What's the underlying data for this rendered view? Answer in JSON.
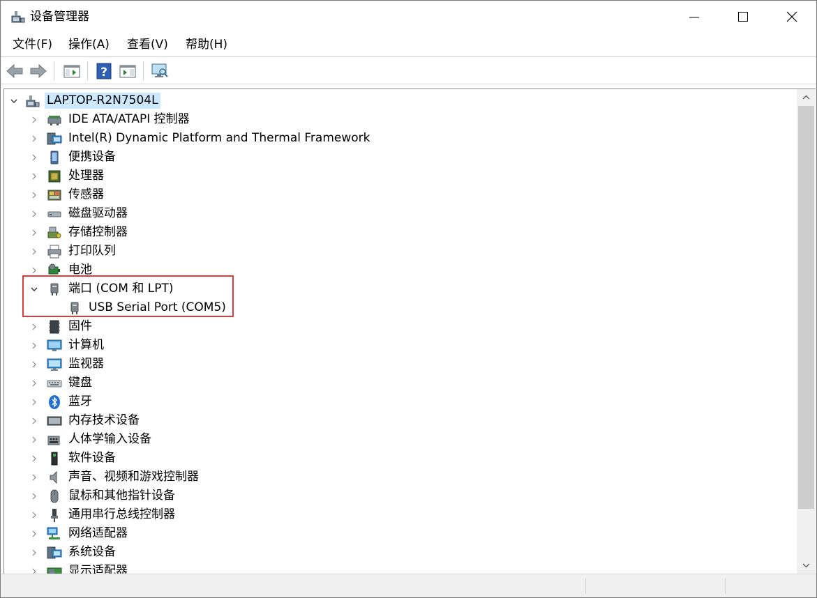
{
  "window": {
    "title": "设备管理器"
  },
  "controls": {
    "minimize": "minimize",
    "maximize": "maximize",
    "close": "close"
  },
  "menu": [
    {
      "label": "文件(F)"
    },
    {
      "label": "操作(A)"
    },
    {
      "label": "查看(V)"
    },
    {
      "label": "帮助(H)"
    }
  ],
  "toolbar": [
    {
      "icon": "back-arrow-icon"
    },
    {
      "icon": "forward-arrow-icon"
    },
    {
      "icon": "show-hide-tree-icon"
    },
    {
      "icon": "help-icon"
    },
    {
      "icon": "properties-icon"
    },
    {
      "icon": "scan-hardware-icon"
    }
  ],
  "tree": {
    "root": {
      "label": "LAPTOP-R2N7504L",
      "expanded": true,
      "icon": "computer-network-icon"
    },
    "items": [
      {
        "label": "IDE ATA/ATAPI 控制器",
        "icon": "ide-controller-icon",
        "expanded": false
      },
      {
        "label": "Intel(R) Dynamic Platform and Thermal Framework",
        "icon": "thermal-framework-icon",
        "expanded": false
      },
      {
        "label": "便携设备",
        "icon": "portable-device-icon",
        "expanded": false
      },
      {
        "label": "处理器",
        "icon": "processor-icon",
        "expanded": false
      },
      {
        "label": "传感器",
        "icon": "sensor-icon",
        "expanded": false
      },
      {
        "label": "磁盘驱动器",
        "icon": "disk-drive-icon",
        "expanded": false
      },
      {
        "label": "存储控制器",
        "icon": "storage-controller-icon",
        "expanded": false
      },
      {
        "label": "打印队列",
        "icon": "printer-icon",
        "expanded": false
      },
      {
        "label": "电池",
        "icon": "battery-icon",
        "expanded": false
      },
      {
        "label": "端口 (COM 和 LPT)",
        "icon": "port-icon",
        "expanded": true
      },
      {
        "label": "USB Serial Port (COM5)",
        "icon": "port-icon",
        "child": true
      },
      {
        "label": "固件",
        "icon": "firmware-icon",
        "expanded": false
      },
      {
        "label": "计算机",
        "icon": "computer-icon",
        "expanded": false
      },
      {
        "label": "监视器",
        "icon": "monitor-icon",
        "expanded": false
      },
      {
        "label": "键盘",
        "icon": "keyboard-icon",
        "expanded": false
      },
      {
        "label": "蓝牙",
        "icon": "bluetooth-icon",
        "expanded": false
      },
      {
        "label": "内存技术设备",
        "icon": "memory-device-icon",
        "expanded": false
      },
      {
        "label": "人体学输入设备",
        "icon": "hid-icon",
        "expanded": false
      },
      {
        "label": "软件设备",
        "icon": "software-device-icon",
        "expanded": false
      },
      {
        "label": "声音、视频和游戏控制器",
        "icon": "speaker-icon",
        "expanded": false
      },
      {
        "label": "鼠标和其他指针设备",
        "icon": "mouse-icon",
        "expanded": false
      },
      {
        "label": "通用串行总线控制器",
        "icon": "usb-icon",
        "expanded": false
      },
      {
        "label": "网络适配器",
        "icon": "network-adapter-icon",
        "expanded": false
      },
      {
        "label": "系统设备",
        "icon": "system-device-icon",
        "expanded": false
      },
      {
        "label": "显示适配器",
        "icon": "display-adapter-icon",
        "expanded": false
      }
    ]
  },
  "colors": {
    "selection": "#cce8ff",
    "highlight_box": "#e03a3a"
  }
}
